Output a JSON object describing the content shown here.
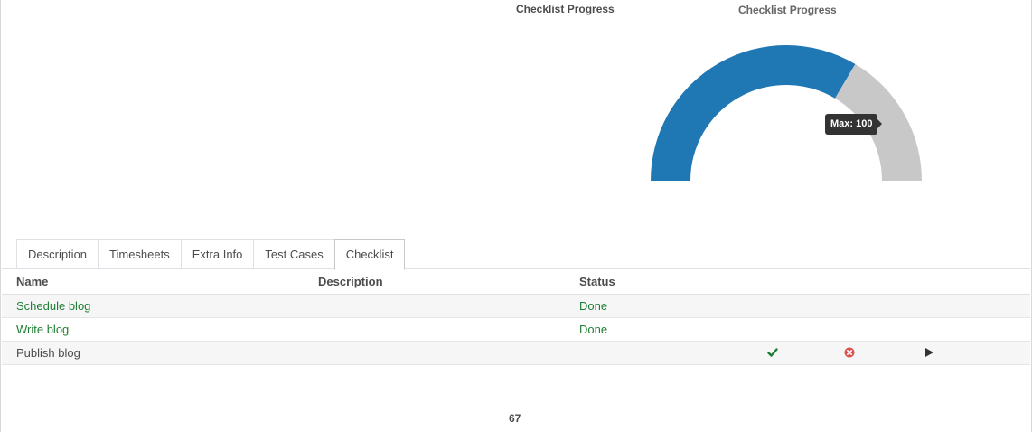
{
  "field": {
    "title": "Checklist Progress"
  },
  "gauge": {
    "title": "Checklist Progress",
    "value": 67,
    "max": 100,
    "tooltip": "Max: 100",
    "value_color": "#1f77b4",
    "rest_color": "#c8c8c8"
  },
  "tabs": [
    {
      "label": "Description",
      "active": false
    },
    {
      "label": "Timesheets",
      "active": false
    },
    {
      "label": "Extra Info",
      "active": false
    },
    {
      "label": "Test Cases",
      "active": false
    },
    {
      "label": "Checklist",
      "active": true
    }
  ],
  "table": {
    "headers": {
      "name": "Name",
      "description": "Description",
      "status": "Status"
    },
    "rows": [
      {
        "name": "Schedule blog",
        "description": "",
        "status": "Done"
      },
      {
        "name": "Write blog",
        "description": "",
        "status": "Done"
      },
      {
        "name": "Publish blog",
        "description": "",
        "status": "",
        "actions": [
          "check-icon",
          "cancel-icon",
          "play-icon"
        ]
      }
    ]
  },
  "footer": {
    "value": "67"
  },
  "colors": {
    "done": "#1e7e34",
    "check": "#1e7e34",
    "cancel": "#d9534f",
    "play": "#333333"
  }
}
